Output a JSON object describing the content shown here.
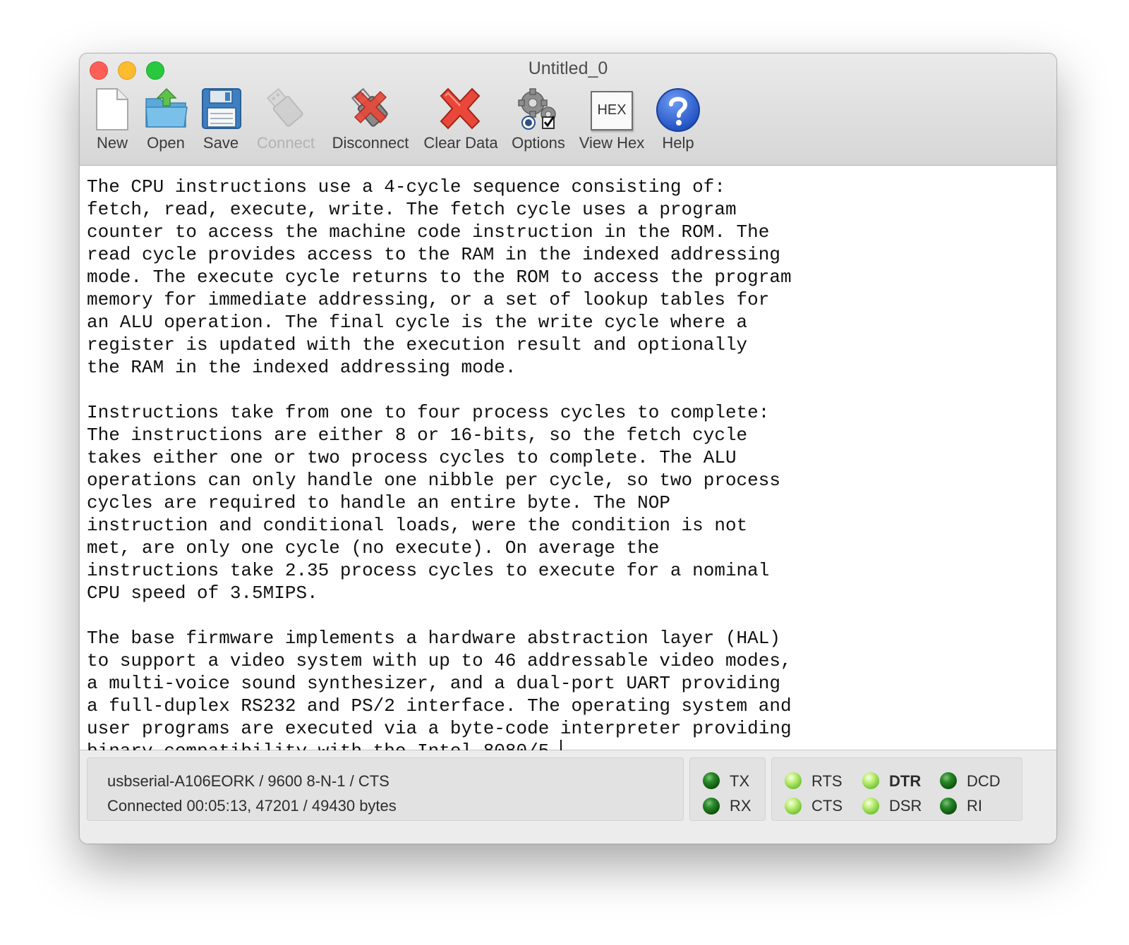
{
  "window": {
    "title": "Untitled_0"
  },
  "toolbar": {
    "new": "New",
    "open": "Open",
    "save": "Save",
    "connect": "Connect",
    "disconnect": "Disconnect",
    "clear_data": "Clear Data",
    "options": "Options",
    "view_hex": "View Hex",
    "hex_icon_text": "HEX",
    "help": "Help"
  },
  "editor": {
    "text": "The CPU instructions use a 4-cycle sequence consisting of:\nfetch, read, execute, write. The fetch cycle uses a program\ncounter to access the machine code instruction in the ROM. The\nread cycle provides access to the RAM in the indexed addressing\nmode. The execute cycle returns to the ROM to access the program\nmemory for immediate addressing, or a set of lookup tables for\nan ALU operation. The final cycle is the write cycle where a\nregister is updated with the execution result and optionally\nthe RAM in the indexed addressing mode.\n\nInstructions take from one to four process cycles to complete:\nThe instructions are either 8 or 16-bits, so the fetch cycle\ntakes either one or two process cycles to complete. The ALU\noperations can only handle one nibble per cycle, so two process\ncycles are required to handle an entire byte. The NOP\ninstruction and conditional loads, were the condition is not\nmet, are only one cycle (no execute). On average the\ninstructions take 2.35 process cycles to execute for a nominal\nCPU speed of 3.5MIPS.\n\nThe base firmware implements a hardware abstraction layer (HAL)\nto support a video system with up to 46 addressable video modes,\na multi-voice sound synthesizer, and a dual-port UART providing\na full-duplex RS232 and PS/2 interface. The operating system and\nuser programs are executed via a byte-code interpreter providing\nbinary compatibility with the Intel 8080/5."
  },
  "status": {
    "port_line": "usbserial-A106EORK / 9600 8-N-1 / CTS",
    "connection_line": "Connected 00:05:13, 47201 / 49430 bytes"
  },
  "signals": {
    "tx": {
      "label": "TX",
      "state": "off"
    },
    "rx": {
      "label": "RX",
      "state": "off"
    },
    "rts": {
      "label": "RTS",
      "state": "on"
    },
    "cts": {
      "label": "CTS",
      "state": "on"
    },
    "dtr": {
      "label": "DTR",
      "state": "on"
    },
    "dsr": {
      "label": "DSR",
      "state": "on"
    },
    "dcd": {
      "label": "DCD",
      "state": "off"
    },
    "ri": {
      "label": "RI",
      "state": "off"
    }
  },
  "colors": {
    "led_on": "#9ce05a",
    "led_off": "#1e6b1e",
    "close": "#fd5f57",
    "minimize": "#fdbb2e",
    "maximize": "#28c83f"
  },
  "icons": {
    "new": "document-icon",
    "open": "folder-open-icon",
    "save": "floppy-disk-icon",
    "connect": "usb-plug-icon",
    "disconnect": "usb-plug-x-icon",
    "clear_data": "red-x-icon",
    "options": "gears-icon",
    "view_hex": "hex-box-icon",
    "help": "question-mark-icon"
  }
}
